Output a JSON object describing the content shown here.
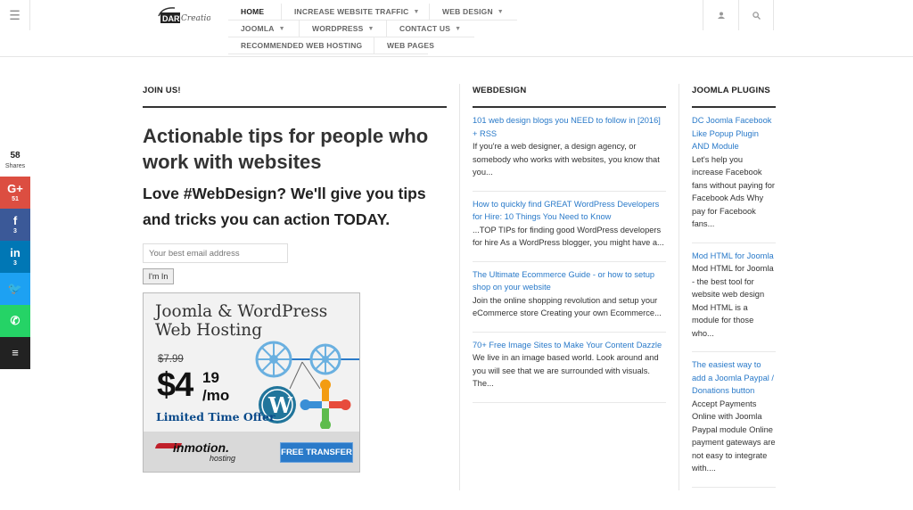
{
  "header": {
    "logo_text": "DART Creations",
    "nav_rows": [
      [
        {
          "label": "HOME",
          "caret": false,
          "active": true
        },
        {
          "label": "INCREASE WEBSITE TRAFFIC",
          "caret": true
        },
        {
          "label": "WEB DESIGN",
          "caret": true
        }
      ],
      [
        {
          "label": "JOOMLA",
          "caret": true
        },
        {
          "label": "WORDPRESS",
          "caret": true
        },
        {
          "label": "CONTACT US",
          "caret": true
        }
      ],
      [
        {
          "label": "RECOMMENDED WEB HOSTING",
          "caret": false
        },
        {
          "label": "WEB PAGES",
          "caret": false
        }
      ]
    ],
    "icons": [
      "menu-icon",
      "user-icon",
      "search-icon"
    ]
  },
  "social": {
    "count": "58",
    "count_label": "Shares",
    "buttons": [
      {
        "name": "google-plus",
        "glyph": "G+",
        "count": "51",
        "color": "#dc4e41"
      },
      {
        "name": "facebook",
        "glyph": "f",
        "count": "3",
        "color": "#3b5998"
      },
      {
        "name": "linkedin",
        "glyph": "in",
        "count": "3",
        "color": "#0077b5"
      },
      {
        "name": "twitter",
        "glyph": "🐦",
        "count": "",
        "color": "#1da1f2"
      },
      {
        "name": "whatsapp",
        "glyph": "✆",
        "count": "",
        "color": "#25d366"
      },
      {
        "name": "buffer",
        "glyph": "≡",
        "count": "",
        "color": "#222222"
      }
    ]
  },
  "join": {
    "title": "JOIN US!",
    "headline": "Actionable tips for people who work with websites",
    "subhead": "Love #WebDesign? We'll give you tips and tricks you can action TODAY.",
    "email_placeholder": "Your best email address",
    "button_label": "I'm In"
  },
  "ad": {
    "title_line1": "Joomla & WordPress",
    "title_line2": "Web Hosting",
    "old_price": "$7.99",
    "price_main": "$4",
    "price_cents": "19",
    "price_unit": "/mo",
    "offer": "Limited Time Offer",
    "brand": "inmotion.",
    "brand_sub": "hosting",
    "cta": "FREE TRANSFER"
  },
  "webdesign": {
    "title": "WEBDESIGN",
    "posts": [
      {
        "link": "101 web design blogs you NEED to follow in [2016] + RSS",
        "text": "If you're a web designer, a design agency, or somebody who works with websites, you know that you..."
      },
      {
        "link": "How to quickly find GREAT WordPress Developers for Hire: 10 Things You Need to Know",
        "text": "...TOP TIPs for finding good WordPress developers for hire As a WordPress blogger, you might have a..."
      },
      {
        "link": "The Ultimate Ecommerce Guide - or how to setup shop on your website",
        "text": "Join the online shopping revolution and setup your eCommerce store Creating your own Ecommerce..."
      },
      {
        "link": "70+ Free Image Sites to Make Your Content Dazzle",
        "text": "We live in an image based world. Look around and you will see that we are surrounded with visuals. The..."
      }
    ]
  },
  "joomla_plugins": {
    "title": "JOOMLA PLUGINS",
    "posts": [
      {
        "link": "DC Joomla Facebook Like Popup Plugin AND Module",
        "text": "Let's help you increase Facebook fans without paying for Facebook Ads Why pay for Facebook fans..."
      },
      {
        "link": "Mod HTML for Joomla",
        "text": "Mod HTML for Joomla - the best tool for website web design Mod HTML is a module for those who..."
      },
      {
        "link": "The easiest way to add a Joomla Paypal / Donations button",
        "text": "Accept Payments Online with Joomla Paypal module Online payment gateways are not easy to integrate with...."
      }
    ]
  }
}
